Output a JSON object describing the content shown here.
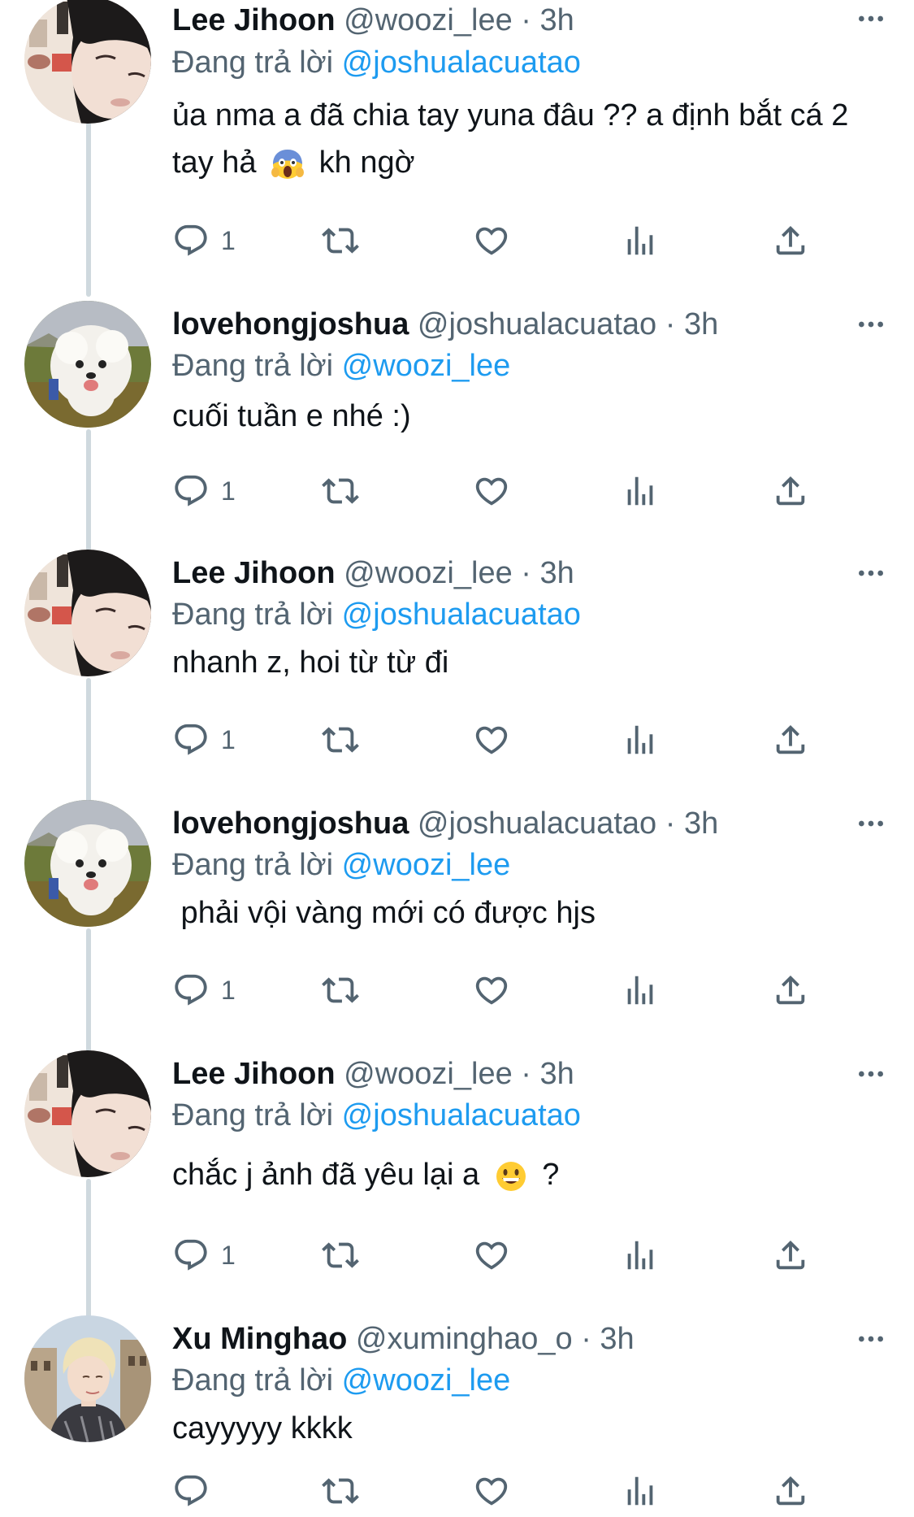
{
  "reply_prefix": "Đang trả lời",
  "tweets": [
    {
      "name": "Lee Jihoon",
      "handle": "@woozi_lee",
      "dot": "·",
      "time": "3h",
      "reply_to": "@joshualacuatao",
      "text_part1": "ủa nma a đã chia tay yuna đâu ?? a định bắt cá 2 tay hả",
      "text_emoji": "scream-emoji",
      "text_part2": "kh ngờ",
      "reply_count": "1"
    },
    {
      "name": "lovehongjoshua",
      "handle": "@joshualacuatao",
      "dot": "·",
      "time": "3h",
      "reply_to": "@woozi_lee",
      "text": "cuối tuần e nhé :)",
      "reply_count": "1"
    },
    {
      "name": "Lee Jihoon",
      "handle": "@woozi_lee",
      "dot": "·",
      "time": "3h",
      "reply_to": "@joshualacuatao",
      "text": "nhanh z, hoi từ từ đi",
      "reply_count": "1"
    },
    {
      "name": "lovehongjoshua",
      "handle": "@joshualacuatao",
      "dot": "·",
      "time": "3h",
      "reply_to": "@woozi_lee",
      "text": " phải vội vàng mới có được hjs",
      "reply_count": "1"
    },
    {
      "name": "Lee Jihoon",
      "handle": "@woozi_lee",
      "dot": "·",
      "time": "3h",
      "reply_to": "@joshualacuatao",
      "text_part1": "chắc j ảnh đã yêu lại a",
      "text_emoji": "grinning-emoji",
      "text_part2": "?",
      "reply_count": "1"
    },
    {
      "name": "Xu Minghao",
      "handle": "@xuminghao_o",
      "dot": "·",
      "time": "3h",
      "reply_to": "@woozi_lee",
      "text": "cayyyyy kkkk",
      "reply_count": ""
    }
  ],
  "icons": {
    "reply": "reply-icon",
    "retweet": "retweet-icon",
    "like": "heart-icon",
    "views": "views-icon",
    "share": "share-icon",
    "more": "more-icon"
  },
  "colors": {
    "text": "#0f1419",
    "secondary": "#536471",
    "mention": "#1d9bf0",
    "thread_line": "#cfd9de"
  }
}
